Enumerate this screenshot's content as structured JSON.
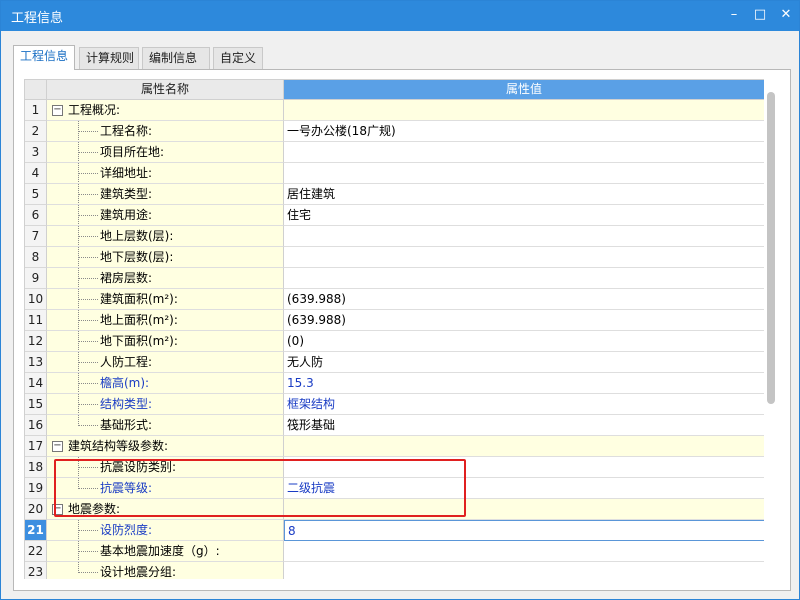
{
  "window": {
    "title": "工程信息",
    "buttons": {
      "minimize": "–",
      "maximize": "□",
      "close": "✕"
    }
  },
  "tabs": [
    {
      "label": "工程信息",
      "active": true
    },
    {
      "label": "计算规则",
      "active": false
    },
    {
      "label": "编制信息",
      "active": false
    },
    {
      "label": "自定义",
      "active": false
    }
  ],
  "grid": {
    "header": {
      "name": "属性名称",
      "value": "属性值"
    },
    "rows": [
      {
        "num": "1",
        "name": "工程概况:",
        "value": "",
        "group": true,
        "expander": "−"
      },
      {
        "num": "2",
        "name": "工程名称:",
        "value": "一号办公楼(18广规)"
      },
      {
        "num": "3",
        "name": "项目所在地:",
        "value": ""
      },
      {
        "num": "4",
        "name": "详细地址:",
        "value": ""
      },
      {
        "num": "5",
        "name": "建筑类型:",
        "value": "居住建筑"
      },
      {
        "num": "6",
        "name": "建筑用途:",
        "value": "住宅"
      },
      {
        "num": "7",
        "name": "地上层数(层):",
        "value": ""
      },
      {
        "num": "8",
        "name": "地下层数(层):",
        "value": ""
      },
      {
        "num": "9",
        "name": "裙房层数:",
        "value": ""
      },
      {
        "num": "10",
        "name": "建筑面积(m²):",
        "value": "(639.988)"
      },
      {
        "num": "11",
        "name": "地上面积(m²):",
        "value": "(639.988)"
      },
      {
        "num": "12",
        "name": "地下面积(m²):",
        "value": "(0)"
      },
      {
        "num": "13",
        "name": "人防工程:",
        "value": "无人防"
      },
      {
        "num": "14",
        "name": "檐高(m):",
        "value": "15.3",
        "blue": true
      },
      {
        "num": "15",
        "name": "结构类型:",
        "value": "框架结构",
        "blue": true
      },
      {
        "num": "16",
        "name": "基础形式:",
        "value": "筏形基础"
      },
      {
        "num": "17",
        "name": "建筑结构等级参数:",
        "value": "",
        "group": true,
        "expander": "−"
      },
      {
        "num": "18",
        "name": "抗震设防类别:",
        "value": ""
      },
      {
        "num": "19",
        "name": "抗震等级:",
        "value": "二级抗震",
        "blue": true
      },
      {
        "num": "20",
        "name": "地震参数:",
        "value": "",
        "group": true,
        "expander": "−"
      },
      {
        "num": "21",
        "name": "设防烈度:",
        "value": "8",
        "blue": true,
        "selected": true
      },
      {
        "num": "22",
        "name": "基本地震加速度（g）:",
        "value": ""
      },
      {
        "num": "23",
        "name": "设计地震分组:",
        "value": ""
      }
    ]
  },
  "colors": {
    "titlebar": "#2d89dc",
    "header_value": "#5aa0e6",
    "name_cell": "#ffffe1",
    "highlight": "#e02020",
    "blue_text": "#1a3cc4"
  }
}
